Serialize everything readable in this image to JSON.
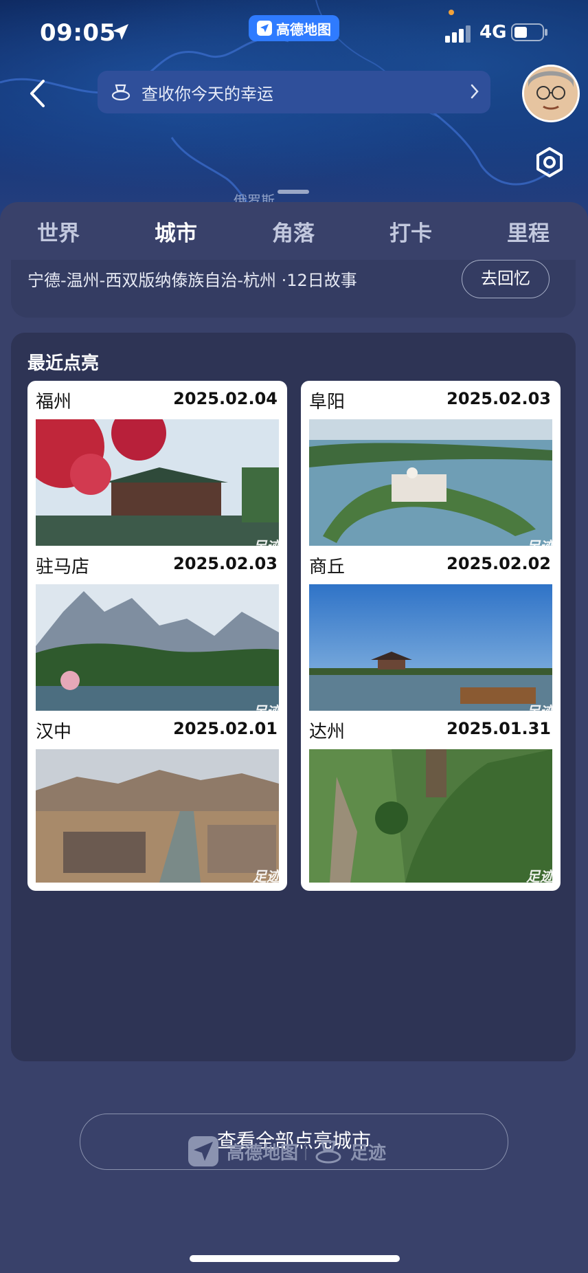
{
  "status_bar": {
    "time": "09:05",
    "network": "4G"
  },
  "app_pill": {
    "label": "高德地图"
  },
  "top_bar": {
    "fortune_text": "查收你今天的幸运"
  },
  "map": {
    "label": "俄罗斯"
  },
  "tabs": [
    {
      "label": "世界",
      "active": false
    },
    {
      "label": "城市",
      "active": true
    },
    {
      "label": "角落",
      "active": false
    },
    {
      "label": "打卡",
      "active": false
    },
    {
      "label": "里程",
      "active": false
    }
  ],
  "story": {
    "text": "宁德-温州-西双版纳傣族自治-杭州 ·12日故事",
    "button": "去回忆"
  },
  "recent": {
    "title": "最近点亮",
    "watermark": "足迹",
    "cities": [
      {
        "name": "福州",
        "date": "2025.02.04"
      },
      {
        "name": "阜阳",
        "date": "2025.02.03"
      },
      {
        "name": "驻马店",
        "date": "2025.02.03"
      },
      {
        "name": "商丘",
        "date": "2025.02.02"
      },
      {
        "name": "汉中",
        "date": "2025.02.01"
      },
      {
        "name": "达州",
        "date": "2025.01.31"
      }
    ],
    "view_all": "查看全部点亮城市"
  },
  "footer": {
    "brand1": "高德地图",
    "brand2": "足迹"
  }
}
